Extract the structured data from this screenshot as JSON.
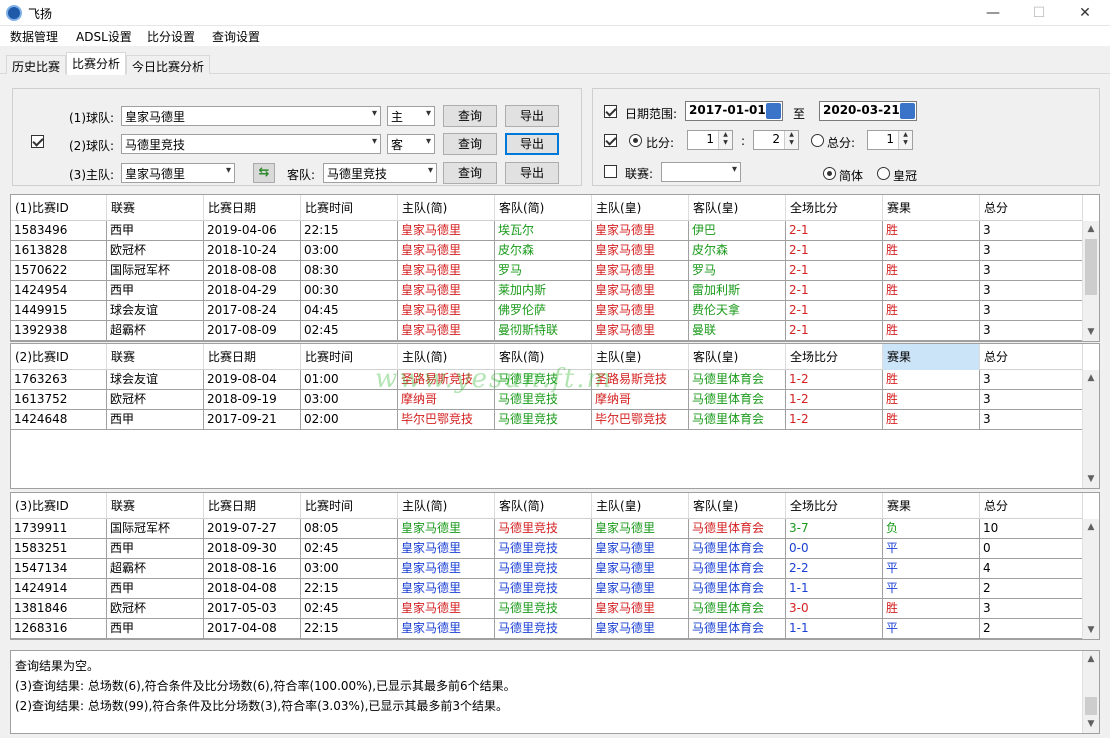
{
  "window": {
    "title": "飞扬",
    "minimize": "—",
    "maximize": "☐",
    "close": "✕"
  },
  "menu": [
    "数据管理",
    "ADSL设置",
    "比分设置",
    "查询设置"
  ],
  "tabs": [
    "历史比赛",
    "比赛分析",
    "今日比赛分析"
  ],
  "query": {
    "team1_label": "(1)球队:",
    "team1_value": "皇家马德里",
    "team1_side": "主",
    "team2_label": "(2)球队:",
    "team2_value": "马德里竞技",
    "team2_side": "客",
    "home_label": "(3)主队:",
    "home_value": "皇家马德里",
    "away_label": "客队:",
    "away_value": "马德里竞技",
    "query_btn": "查询",
    "export_btn": "导出"
  },
  "filters": {
    "date_label": "日期范围:",
    "date_from": "2017-01-01",
    "date_to_label": "至",
    "date_to": "2020-03-21",
    "score_label": "比分:",
    "score_home": "1",
    "score_sep": ":",
    "score_away": "2",
    "total_label": "总分:",
    "total_value": "1",
    "league_label": "联赛:",
    "league_value": "",
    "simplified_label": "简体",
    "crown_label": "皇冠"
  },
  "grid_headers": {
    "g1": [
      "(1)比赛ID",
      "联赛",
      "比赛日期",
      "比赛时间",
      "主队(简)",
      "客队(简)",
      "主队(皇)",
      "客队(皇)",
      "全场比分",
      "赛果",
      "总分"
    ],
    "g2": [
      "(2)比赛ID",
      "联赛",
      "比赛日期",
      "比赛时间",
      "主队(简)",
      "客队(简)",
      "主队(皇)",
      "客队(皇)",
      "全场比分",
      "赛果",
      "总分"
    ],
    "g3": [
      "(3)比赛ID",
      "联赛",
      "比赛日期",
      "比赛时间",
      "主队(简)",
      "客队(简)",
      "主队(皇)",
      "客队(皇)",
      "全场比分",
      "赛果",
      "总分"
    ]
  },
  "grid1": [
    [
      "1583496",
      "西甲",
      "2019-04-06",
      "22:15",
      "皇家马德里",
      "埃瓦尔",
      "皇家马德里",
      "伊巴",
      "2-1",
      "胜",
      "3"
    ],
    [
      "1613828",
      "欧冠杯",
      "2018-10-24",
      "03:00",
      "皇家马德里",
      "皮尔森",
      "皇家马德里",
      "皮尔森",
      "2-1",
      "胜",
      "3"
    ],
    [
      "1570622",
      "国际冠军杯",
      "2018-08-08",
      "08:30",
      "皇家马德里",
      "罗马",
      "皇家马德里",
      "罗马",
      "2-1",
      "胜",
      "3"
    ],
    [
      "1424954",
      "西甲",
      "2018-04-29",
      "00:30",
      "皇家马德里",
      "莱加内斯",
      "皇家马德里",
      "雷加利斯",
      "2-1",
      "胜",
      "3"
    ],
    [
      "1449915",
      "球会友谊",
      "2017-08-24",
      "04:45",
      "皇家马德里",
      "佛罗伦萨",
      "皇家马德里",
      "费伦天拿",
      "2-1",
      "胜",
      "3"
    ],
    [
      "1392938",
      "超霸杯",
      "2017-08-09",
      "02:45",
      "皇家马德里",
      "曼彻斯特联",
      "皇家马德里",
      "曼联",
      "2-1",
      "胜",
      "3"
    ]
  ],
  "grid2": [
    [
      "1763263",
      "球会友谊",
      "2019-08-04",
      "01:00",
      "圣路易斯竞技",
      "马德里竞技",
      "圣路易斯竞技",
      "马德里体育会",
      "1-2",
      "胜",
      "3"
    ],
    [
      "1613752",
      "欧冠杯",
      "2018-09-19",
      "03:00",
      "摩纳哥",
      "马德里竞技",
      "摩纳哥",
      "马德里体育会",
      "1-2",
      "胜",
      "3"
    ],
    [
      "1424648",
      "西甲",
      "2017-09-21",
      "02:00",
      "毕尔巴鄂竞技",
      "马德里竞技",
      "毕尔巴鄂竞技",
      "马德里体育会",
      "1-2",
      "胜",
      "3"
    ]
  ],
  "grid3": [
    [
      "1739911",
      "国际冠军杯",
      "2019-07-27",
      "08:05",
      "皇家马德里",
      "马德里竞技",
      "皇家马德里",
      "马德里体育会",
      "3-7",
      "负",
      "10"
    ],
    [
      "1583251",
      "西甲",
      "2018-09-30",
      "02:45",
      "皇家马德里",
      "马德里竞技",
      "皇家马德里",
      "马德里体育会",
      "0-0",
      "平",
      "0"
    ],
    [
      "1547134",
      "超霸杯",
      "2018-08-16",
      "03:00",
      "皇家马德里",
      "马德里竞技",
      "皇家马德里",
      "马德里体育会",
      "2-2",
      "平",
      "4"
    ],
    [
      "1424914",
      "西甲",
      "2018-04-08",
      "22:15",
      "皇家马德里",
      "马德里竞技",
      "皇家马德里",
      "马德里体育会",
      "1-1",
      "平",
      "2"
    ],
    [
      "1381846",
      "欧冠杯",
      "2017-05-03",
      "02:45",
      "皇家马德里",
      "马德里竞技",
      "皇家马德里",
      "马德里体育会",
      "3-0",
      "胜",
      "3"
    ],
    [
      "1268316",
      "西甲",
      "2017-04-08",
      "22:15",
      "皇家马德里",
      "马德里竞技",
      "皇家马德里",
      "马德里体育会",
      "1-1",
      "平",
      "2"
    ]
  ],
  "grid3_colors": [
    "g",
    "b",
    "b",
    "b",
    "r",
    "b"
  ],
  "watermark": "www.yesun.ft.m",
  "log": [
    "查询结果为空。",
    "(3)查询结果: 总场数(6),符合条件及比分场数(6),符合率(100.00%),已显示其最多前6个结果。",
    "(2)查询结果: 总场数(99),符合条件及比分场数(3),符合率(3.03%),已显示其最多前3个结果。"
  ]
}
